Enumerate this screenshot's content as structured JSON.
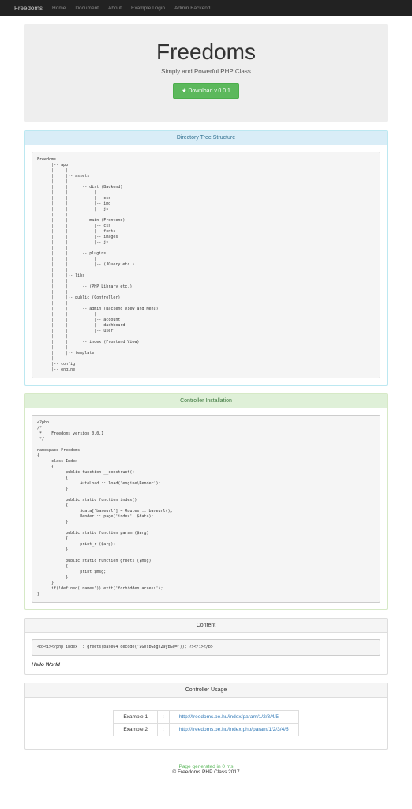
{
  "navbar": {
    "brand": "Freedoms",
    "items": [
      {
        "label": "Home"
      },
      {
        "label": "Document"
      },
      {
        "label": "About"
      },
      {
        "label": "Example Login"
      },
      {
        "label": "Admin Backend"
      }
    ]
  },
  "hero": {
    "title": "Freedoms",
    "subtitle": "Simply and Powerful PHP Class",
    "button": "Download v.0.0.1"
  },
  "panels": {
    "tree": {
      "heading": "Directory Tree Structure",
      "body": "Freedoms\n      |-- app\n      |     |\n      |     |-- assets\n      |     |     |\n      |     |     |-- dist (Backend)\n      |     |     |     |\n      |     |     |     |-- css\n      |     |     |     |-- img\n      |     |     |     |-- js\n      |     |     |\n      |     |     |-- main (Frontend)\n      |     |     |     |-- css\n      |     |     |     |-- fonts\n      |     |     |     |-- images\n      |     |     |     |-- js\n      |     |     |\n      |     |     |-- plugins\n      |     |           |\n      |     |           |-- (JQuery etc.)\n      |     |\n      |     |-- libs\n      |     |     |\n      |     |     |-- (PHP Library etc.)\n      |     |\n      |     |-- public (Controller)\n      |     |     |\n      |     |     |-- admin (Backend View and Menu)\n      |     |     |     |\n      |     |     |     |-- account\n      |     |     |     |-- dashboard\n      |     |     |     |-- user\n      |     |     |\n      |     |     |-- index (Frontend View)\n      |     |\n      |     |-- template\n      |\n      |-- config\n      |-- engine"
    },
    "controller": {
      "heading": "Controller Installation",
      "body": "<?php\n/*\n *    Freedoms version 0.0.1\n */\n\nnamespace Freedoms\n{\n      class Index\n      {\n            public function __construct()\n            {\n                  AutoLoad :: load('engine\\Render');\n            }\n\n            public static function index()\n            {\n                  $data[\"baseurl\"] = Routes :: baseurl();\n                  Render :: page('index', $data);\n            }\n\n            public static function param ($arg)\n            {\n                  print_r ($arg);\n            }\n\n            public static function greets ($msg)\n            {\n                  print $msg;\n            }\n      }\n      if(!defined('names')) exit('forbidden access');\n}"
    },
    "content": {
      "heading": "Content",
      "body": "<b><i><?php index :: greets(base64_decode('SGVsbG8gV29ybGQ=')); ?></i></b>",
      "result": "Hello World"
    },
    "usage": {
      "heading": "Controller Usage",
      "rows": [
        {
          "label": "Example 1",
          "url": "http://freedoms.pe.hu/index/param/1/2/3/4/5"
        },
        {
          "label": "Example 2",
          "url": "http://freedoms.pe.hu/index.php/param/1/2/3/4/5"
        }
      ]
    }
  },
  "footer": {
    "generated": "Page generated in 0 ms",
    "copyright": "© Freedoms PHP Class 2017"
  }
}
